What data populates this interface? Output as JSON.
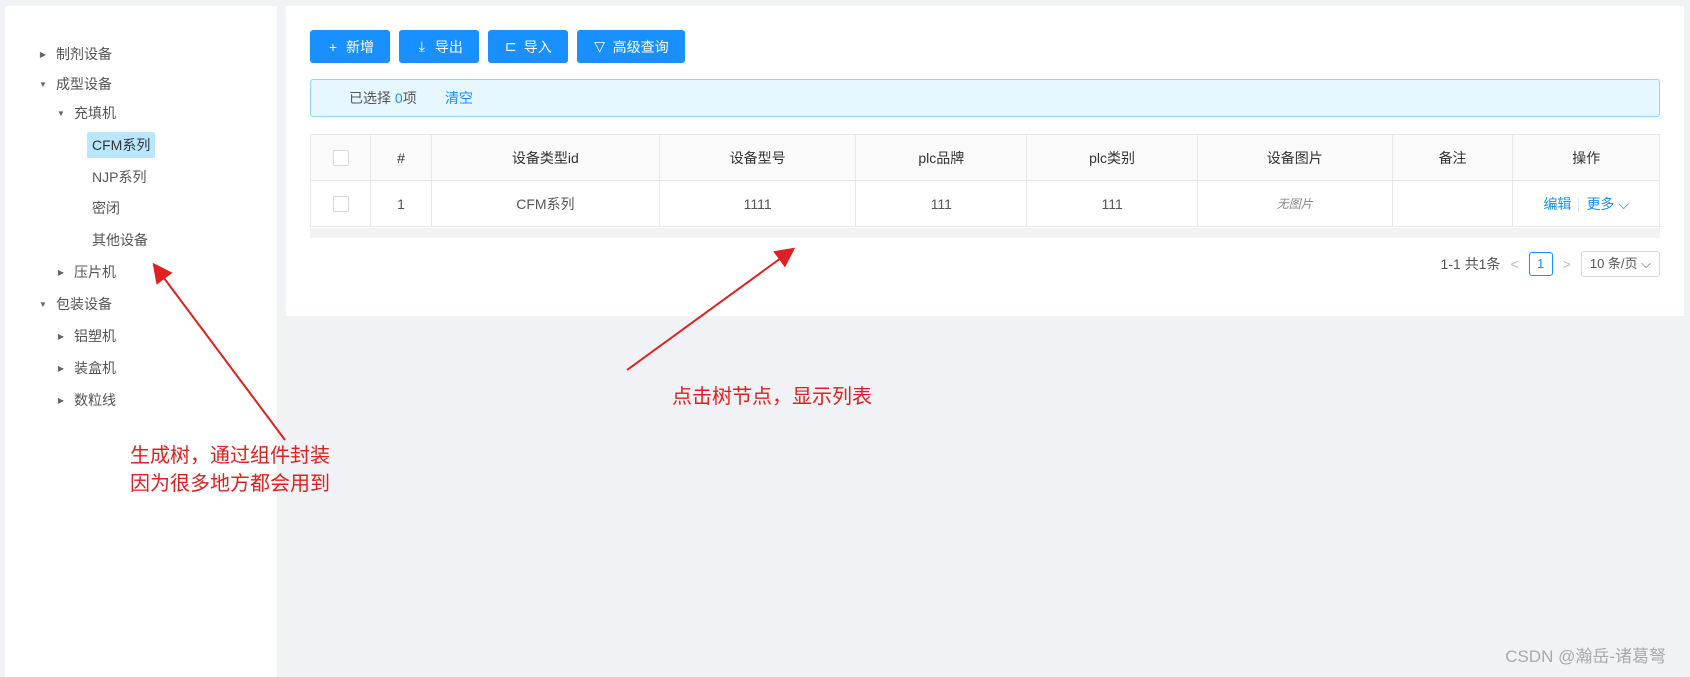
{
  "tree": {
    "nodes": [
      {
        "label": "制剂设备",
        "arrow": "▶"
      },
      {
        "label": "成型设备",
        "arrow": "▼"
      },
      {
        "label": "充填机",
        "arrow": "▼"
      },
      {
        "label": "CFM系列",
        "arrow": ""
      },
      {
        "label": "NJP系列",
        "arrow": ""
      },
      {
        "label": "密闭",
        "arrow": ""
      },
      {
        "label": "其他设备",
        "arrow": ""
      },
      {
        "label": "压片机",
        "arrow": "▶"
      },
      {
        "label": "包装设备",
        "arrow": "▼"
      },
      {
        "label": "铝塑机",
        "arrow": "▶"
      },
      {
        "label": "装盒机",
        "arrow": "▶"
      },
      {
        "label": "数粒线",
        "arrow": "▶"
      }
    ]
  },
  "toolbar": {
    "add_label": "新增",
    "add_icon": "+",
    "export_label": "导出",
    "export_icon": "⤓",
    "import_label": "导入",
    "import_icon": "⊏",
    "query_label": "高级查询",
    "query_icon": "▽"
  },
  "alert": {
    "selected_prefix": "已选择 ",
    "selected_count": "0",
    "selected_suffix": "项",
    "clear_label": "清空"
  },
  "table": {
    "headers": [
      "#",
      "设备类型id",
      "设备型号",
      "plc品牌",
      "plc类别",
      "设备图片",
      "备注",
      "操作"
    ],
    "rows": [
      {
        "index": "1",
        "type_id": "CFM系列",
        "model": "1111",
        "plc_brand": "111",
        "plc_type": "111",
        "image": "无图片",
        "remark": "",
        "edit": "编辑",
        "more": "更多 ⌵"
      }
    ]
  },
  "pagination": {
    "summary": "1-1 共1条",
    "prev": "<",
    "current": "1",
    "next": ">",
    "page_size": "10 条/页 ⌵"
  },
  "annotations": {
    "tree_note_line1": "生成树，通过组件封装",
    "tree_note_line2": "因为很多地方都会用到",
    "list_note": "点击树节点，显示列表",
    "color": "#e02020"
  },
  "watermark": "CSDN @瀚岳-诸葛弩"
}
